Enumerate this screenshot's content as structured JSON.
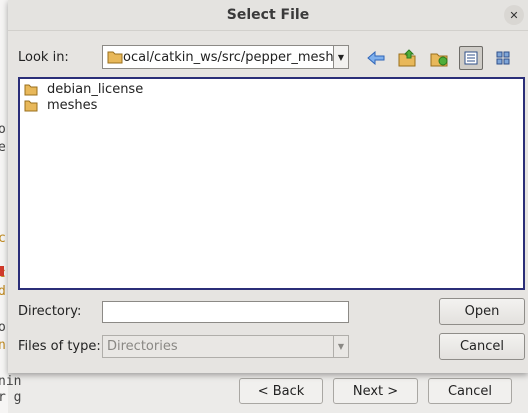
{
  "background": {
    "code_lines": [
      "o",
      "e",
      "c",
      "c",
      "d",
      "o",
      "n",
      "nin",
      "r g",
      "n"
    ],
    "buttons": {
      "back": "< Back",
      "next": "Next >",
      "cancel": "Cancel"
    }
  },
  "dialog": {
    "title": "Select File",
    "look_in_label": "Look in:",
    "look_in_value": "ocal/catkin_ws/src/pepper_meshes",
    "files": [
      {
        "name": "debian_license",
        "icon": "folder-icon"
      },
      {
        "name": "meshes",
        "icon": "folder-icon"
      }
    ],
    "directory_label": "Directory:",
    "directory_value": "",
    "files_of_type_label": "Files of type:",
    "files_of_type_value": "Directories",
    "open_label": "Open",
    "cancel_label": "Cancel",
    "toolbar": [
      "back-arrow-icon",
      "parent-folder-icon",
      "new-folder-icon",
      "list-view-icon",
      "detail-view-icon"
    ]
  },
  "colors": {
    "selection_border": "#2b2e78",
    "back_arrow": "#4a7fd0",
    "folder": "#e8b85a"
  }
}
